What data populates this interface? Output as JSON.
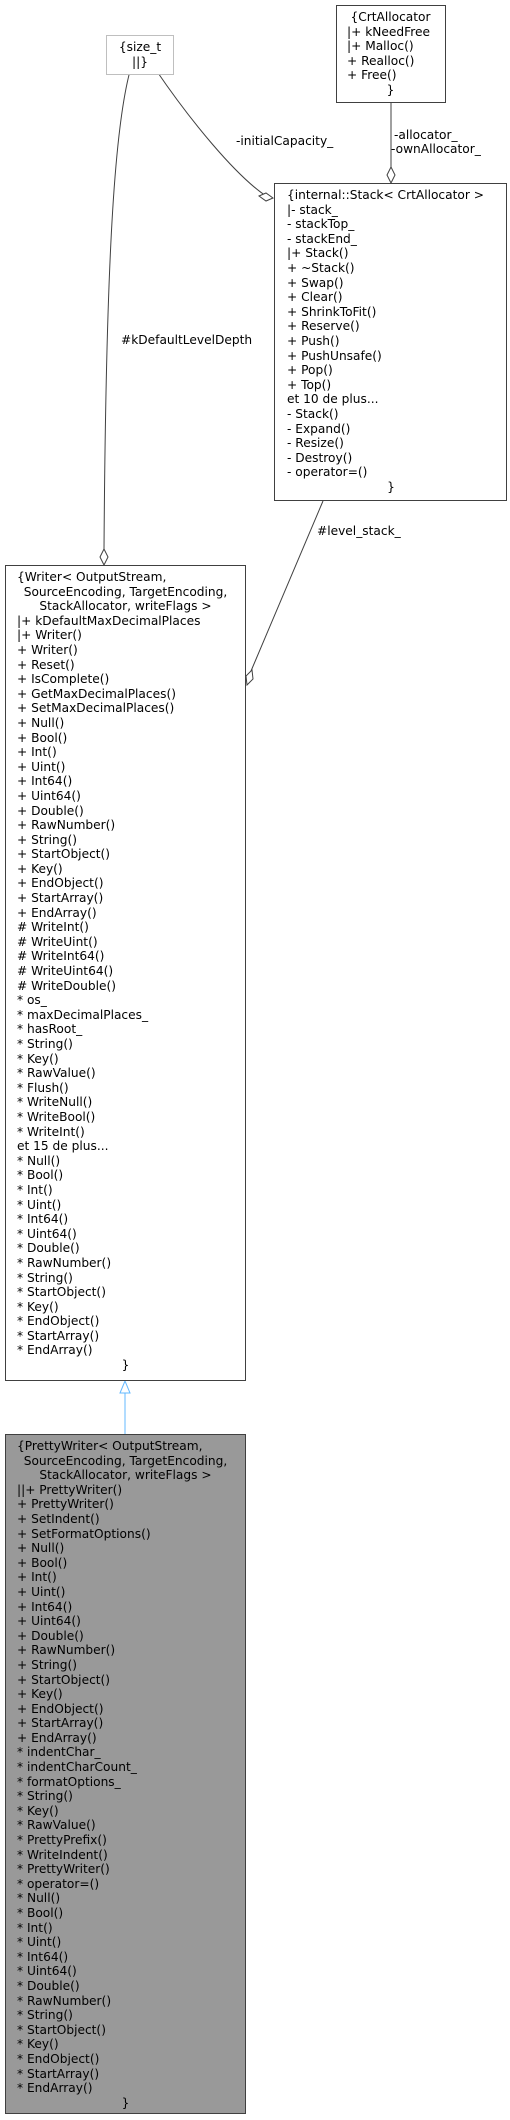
{
  "nodes": {
    "size_t": {
      "lines": [
        "{size_t",
        "||}"
      ]
    },
    "crt_allocator": {
      "title": "{CrtAllocator",
      "lines": [
        "|+ kNeedFree",
        "|+ Malloc()",
        "+ Realloc()",
        "+ Free()"
      ],
      "close": "}"
    },
    "stack": {
      "title": "{internal::Stack< CrtAllocator >",
      "lines": [
        "|- stack_",
        "- stackTop_",
        "- stackEnd_",
        "|+ Stack()",
        "+ ~Stack()",
        "+ Swap()",
        "+ Clear()",
        "+ ShrinkToFit()",
        "+ Reserve()",
        "+ Push()",
        "+ PushUnsafe()",
        "+ Pop()",
        "+ Top()",
        "et 10 de plus...",
        "- Stack()",
        "- Expand()",
        "- Resize()",
        "- Destroy()",
        "- operator=()"
      ],
      "close": "}"
    },
    "writer": {
      "title_lines": [
        "{Writer< OutputStream,",
        "SourceEncoding, TargetEncoding,",
        "StackAllocator, writeFlags >"
      ],
      "lines": [
        "|+ kDefaultMaxDecimalPlaces",
        "|+ Writer()",
        "+ Writer()",
        "+ Reset()",
        "+ IsComplete()",
        "+ GetMaxDecimalPlaces()",
        "+ SetMaxDecimalPlaces()",
        "+ Null()",
        "+ Bool()",
        "+ Int()",
        "+ Uint()",
        "+ Int64()",
        "+ Uint64()",
        "+ Double()",
        "+ RawNumber()",
        "+ String()",
        "+ StartObject()",
        "+ Key()",
        "+ EndObject()",
        "+ StartArray()",
        "+ EndArray()",
        "# WriteInt()",
        "# WriteUint()",
        "# WriteInt64()",
        "# WriteUint64()",
        "# WriteDouble()",
        "* os_",
        "* maxDecimalPlaces_",
        "* hasRoot_",
        "* String()",
        "* Key()",
        "* RawValue()",
        "* Flush()",
        "* WriteNull()",
        "* WriteBool()",
        "* WriteInt()",
        "et 15 de plus...",
        "* Null()",
        "* Bool()",
        "* Int()",
        "* Uint()",
        "* Int64()",
        "* Uint64()",
        "* Double()",
        "* RawNumber()",
        "* String()",
        "* StartObject()",
        "* Key()",
        "* EndObject()",
        "* StartArray()",
        "* EndArray()"
      ],
      "close": "}"
    },
    "pretty_writer": {
      "title_lines": [
        "{PrettyWriter< OutputStream,",
        "SourceEncoding, TargetEncoding,",
        "StackAllocator, writeFlags >"
      ],
      "lines": [
        "||+ PrettyWriter()",
        "+ PrettyWriter()",
        "+ SetIndent()",
        "+ SetFormatOptions()",
        "+ Null()",
        "+ Bool()",
        "+ Int()",
        "+ Uint()",
        "+ Int64()",
        "+ Uint64()",
        "+ Double()",
        "+ RawNumber()",
        "+ String()",
        "+ StartObject()",
        "+ Key()",
        "+ EndObject()",
        "+ StartArray()",
        "+ EndArray()",
        "* indentChar_",
        "* indentCharCount_",
        "* formatOptions_",
        "* String()",
        "* Key()",
        "* RawValue()",
        "* PrettyPrefix()",
        "* WriteIndent()",
        "* PrettyWriter()",
        "* operator=()",
        "* Null()",
        "* Bool()",
        "* Int()",
        "* Uint()",
        "* Int64()",
        "* Uint64()",
        "* Double()",
        "* RawNumber()",
        "* String()",
        "* StartObject()",
        "* Key()",
        "* EndObject()",
        "* StartArray()",
        "* EndArray()"
      ],
      "close": "}"
    }
  },
  "edge_labels": {
    "initial_capacity": "-initialCapacity_",
    "allocator": "-allocator_",
    "own_allocator": "-ownAllocator_",
    "default_level_depth": "#kDefaultLevelDepth",
    "level_stack": "#level_stack_"
  },
  "colors": {
    "edge": "#404040",
    "inheritance": "#63b8ff",
    "derived_fill": "#999999"
  }
}
